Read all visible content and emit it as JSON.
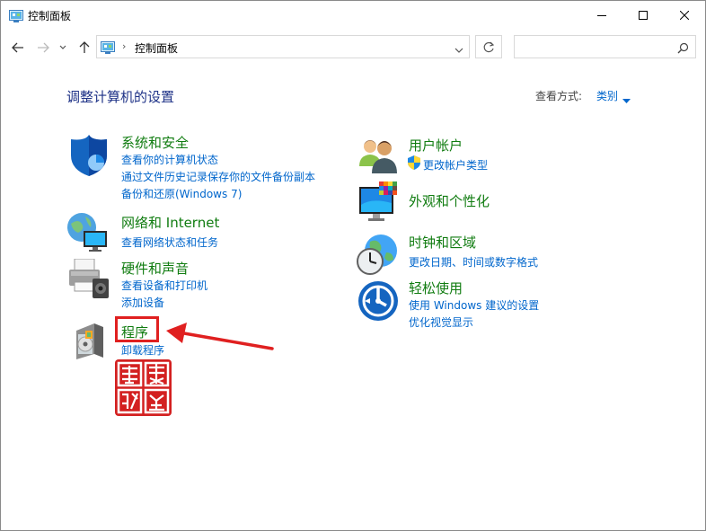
{
  "window": {
    "title": "控制面板"
  },
  "address_bar": {
    "separator": "›",
    "breadcrumb": "控制面板"
  },
  "search": {
    "placeholder": ""
  },
  "main": {
    "heading": "调整计算机的设置",
    "view_by_label": "查看方式:",
    "view_by_value": "类别"
  },
  "categories": [
    {
      "title": "系统和安全",
      "links": [
        "查看你的计算机状态",
        "通过文件历史记录保存你的文件备份副本",
        "备份和还原(Windows 7)"
      ]
    },
    {
      "title": "网络和 Internet",
      "links": [
        "查看网络状态和任务"
      ]
    },
    {
      "title": "硬件和声音",
      "links": [
        "查看设备和打印机",
        "添加设备"
      ]
    },
    {
      "title": "程序",
      "links": [
        "卸载程序"
      ]
    },
    {
      "title": "用户帐户",
      "links": [
        "更改帐户类型"
      ]
    },
    {
      "title": "外观和个性化",
      "links": []
    },
    {
      "title": "时钟和区域",
      "links": [
        "更改日期、时间或数字格式"
      ]
    },
    {
      "title": "轻松使用",
      "links": [
        "使用 Windows 建议的设置",
        "优化视觉显示"
      ]
    }
  ],
  "colors": {
    "category_title": "#107c10",
    "link": "#0066cc",
    "heading": "#1e3287",
    "highlight": "#e02020"
  }
}
